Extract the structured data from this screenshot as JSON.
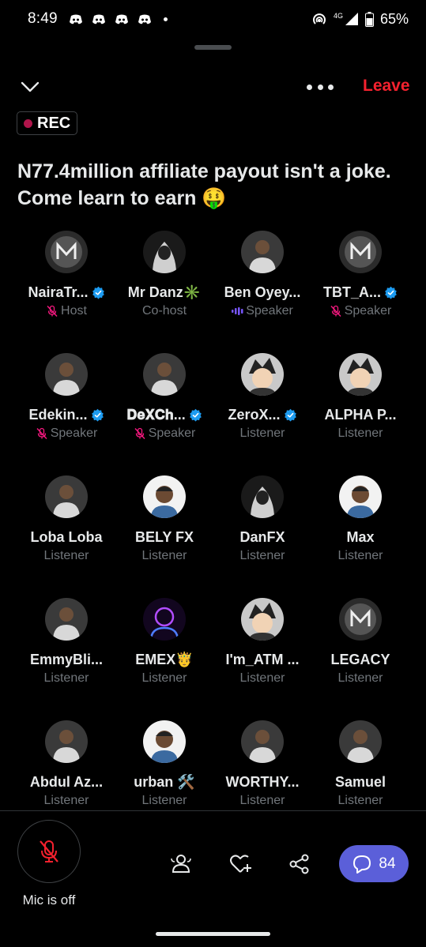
{
  "status_bar": {
    "time": "8:49",
    "network": "4G",
    "battery": "65%",
    "notification_icons": [
      "discord-icon",
      "discord-icon",
      "discord-icon",
      "discord-icon"
    ]
  },
  "header": {
    "leave_label": "Leave",
    "rec_label": "REC",
    "accent_color": "#f4212e"
  },
  "space": {
    "title": "N77.4million affiliate payout isn't a joke. Come learn to earn 🤑"
  },
  "participants": [
    {
      "name": "NairaTr...",
      "role": "Host",
      "verified": true,
      "muted": true,
      "speaking": false,
      "avatar": "logo-avatar"
    },
    {
      "name": "Mr Danz✳️",
      "role": "Co-host",
      "verified": false,
      "muted": false,
      "speaking": false,
      "avatar": "hoodie-avatar"
    },
    {
      "name": "Ben Oyey...",
      "role": "Speaker",
      "verified": false,
      "muted": false,
      "speaking": true,
      "avatar": "photo-avatar"
    },
    {
      "name": "TBT_A...",
      "role": "Speaker",
      "verified": true,
      "muted": true,
      "speaking": false,
      "avatar": "logo-avatar"
    },
    {
      "name": "Edekin...",
      "role": "Speaker",
      "verified": true,
      "muted": true,
      "speaking": false,
      "avatar": "photo-avatar"
    },
    {
      "name": "𝐃𝐞𝐗𝐂𝐡...",
      "role": "Speaker",
      "verified": true,
      "muted": true,
      "speaking": false,
      "avatar": "photo-avatar"
    },
    {
      "name": "ZeroX...",
      "role": "Listener",
      "verified": true,
      "muted": false,
      "speaking": false,
      "avatar": "anime-avatar"
    },
    {
      "name": "ALPHA P...",
      "role": "Listener",
      "verified": false,
      "muted": false,
      "speaking": false,
      "avatar": "anime-avatar"
    },
    {
      "name": "Loba Loba",
      "role": "Listener",
      "verified": false,
      "muted": false,
      "speaking": false,
      "avatar": "photo-avatar"
    },
    {
      "name": "BELY FX",
      "role": "Listener",
      "verified": false,
      "muted": false,
      "speaking": false,
      "avatar": "cartoon-avatar"
    },
    {
      "name": "DanFX",
      "role": "Listener",
      "verified": false,
      "muted": false,
      "speaking": false,
      "avatar": "hoodie-avatar"
    },
    {
      "name": "Max",
      "role": "Listener",
      "verified": false,
      "muted": false,
      "speaking": false,
      "avatar": "cartoon-avatar"
    },
    {
      "name": "EmmyBli...",
      "role": "Listener",
      "verified": false,
      "muted": false,
      "speaking": false,
      "avatar": "photo-avatar"
    },
    {
      "name": "EMEX🤴",
      "role": "Listener",
      "verified": false,
      "muted": false,
      "speaking": false,
      "avatar": "neon-avatar"
    },
    {
      "name": "I'm_ATM ...",
      "role": "Listener",
      "verified": false,
      "muted": false,
      "speaking": false,
      "avatar": "anime-avatar"
    },
    {
      "name": "LEGACY",
      "role": "Listener",
      "verified": false,
      "muted": false,
      "speaking": false,
      "avatar": "logo-avatar"
    },
    {
      "name": "Abdul Az...",
      "role": "Listener",
      "verified": false,
      "muted": false,
      "speaking": false,
      "avatar": "photo-avatar"
    },
    {
      "name": "urban 🛠️",
      "role": "Listener",
      "verified": false,
      "muted": false,
      "speaking": false,
      "avatar": "cartoon-avatar"
    },
    {
      "name": "WORTHY...",
      "role": "Listener",
      "verified": false,
      "muted": false,
      "speaking": false,
      "avatar": "photo-avatar"
    },
    {
      "name": "Samuel",
      "role": "Listener",
      "verified": false,
      "muted": false,
      "speaking": false,
      "avatar": "photo-avatar"
    }
  ],
  "bottom_bar": {
    "mic_label": "Mic is off",
    "chat_count": "84",
    "chat_color": "#5b5fd9"
  }
}
